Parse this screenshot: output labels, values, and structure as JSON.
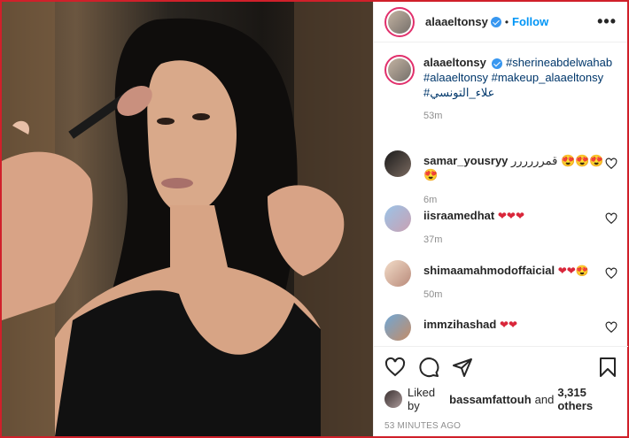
{
  "post": {
    "username": "alaaeltonsy",
    "follow_label": "Follow",
    "separator": "•",
    "more_label": "•••",
    "caption": {
      "username": "alaaeltonsy",
      "hashtags_line1": "#sherineabdelwahab",
      "hashtags_line2": "#alaaeltonsy #makeup_alaaeltonsy",
      "hashtags_line3": "#علاء_التونسي",
      "time": "53m"
    }
  },
  "comments": [
    {
      "user": "samar_yousryy",
      "text": "قمرررررر",
      "emoji": "😍😍😍😍",
      "time": "6m"
    },
    {
      "user": "iisraamedhat",
      "text": "",
      "emoji": "❤❤❤",
      "time": "37m"
    },
    {
      "user": "shimaamahmodoffaicial",
      "text": "",
      "emoji": "❤❤😍",
      "time": "50m"
    },
    {
      "user": "immzihashad",
      "text": "",
      "emoji": "❤❤",
      "time": ""
    }
  ],
  "likes": {
    "prefix": "Liked by",
    "user": "bassamfattouh",
    "middle": "and",
    "others": "3,315 others"
  },
  "timestamp": "53 MINUTES AGO",
  "icons": [
    "heart-icon",
    "comment-icon",
    "share-icon",
    "bookmark-icon",
    "verified-icon",
    "more-icon"
  ],
  "colors": {
    "accent": "#0095f6",
    "verified": "#3897f0",
    "like_red": "#d9263a",
    "frame": "#d0202a"
  }
}
